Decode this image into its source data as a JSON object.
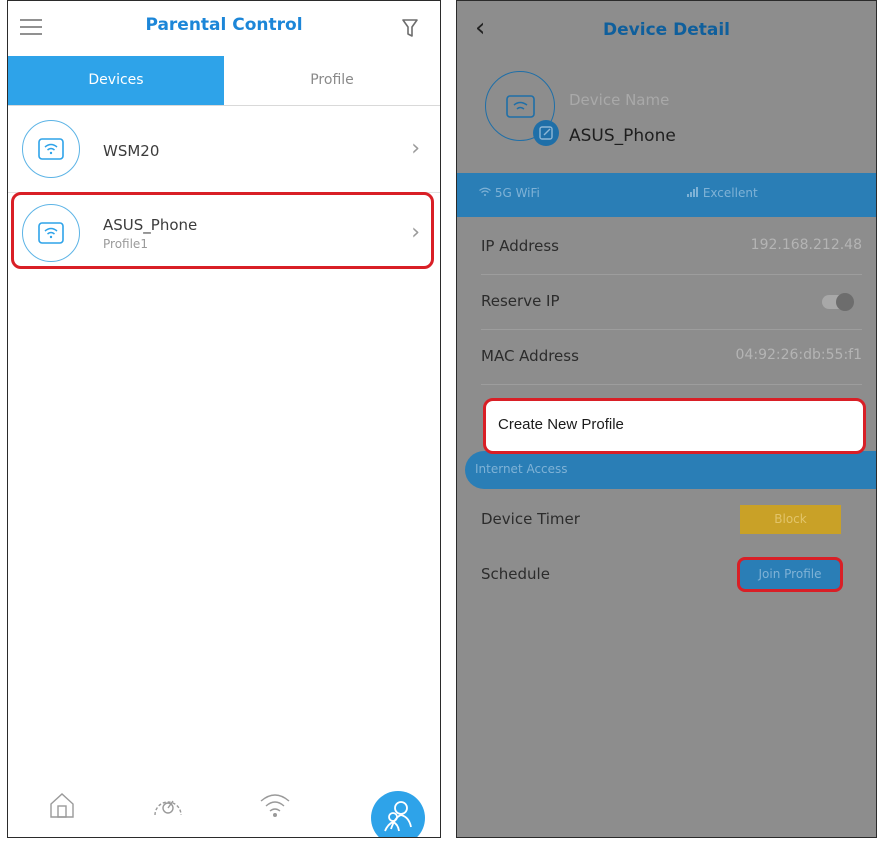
{
  "left": {
    "header": {
      "title": "Parental Control"
    },
    "tabs": [
      {
        "label": "Devices"
      },
      {
        "label": "Profile"
      }
    ],
    "devices": [
      {
        "name": "WSM20",
        "sub": ""
      },
      {
        "name": "ASUS_Phone",
        "sub": "Profile1"
      }
    ],
    "bottom_nav": [
      "home-icon",
      "speedometer-icon",
      "wifi-icon",
      "parental-icon"
    ]
  },
  "right": {
    "header": {
      "title": "Device Detail"
    },
    "device_name_label": "Device Name",
    "device_name": "ASUS_Phone",
    "band": {
      "wifi": "5G WiFi",
      "signal": "Excellent"
    },
    "rows": [
      {
        "label": "IP Address",
        "value": "192.168.212.48"
      },
      {
        "label": "Reserve IP"
      },
      {
        "label": "MAC Address",
        "value": "04:92:26:db:55:f1"
      }
    ],
    "popup": {
      "label": "Create New Profile"
    },
    "internet_access": "Internet Access",
    "device_timer": {
      "label": "Device Timer",
      "button": "Block"
    },
    "schedule": {
      "label": "Schedule",
      "button": "Join Profile"
    }
  },
  "colors": {
    "accent": "#2ea3e9",
    "title_blue": "#1c86d8",
    "highlight": "#d91f26",
    "overlay": "#8d8d8d",
    "block": "#c9a127"
  }
}
